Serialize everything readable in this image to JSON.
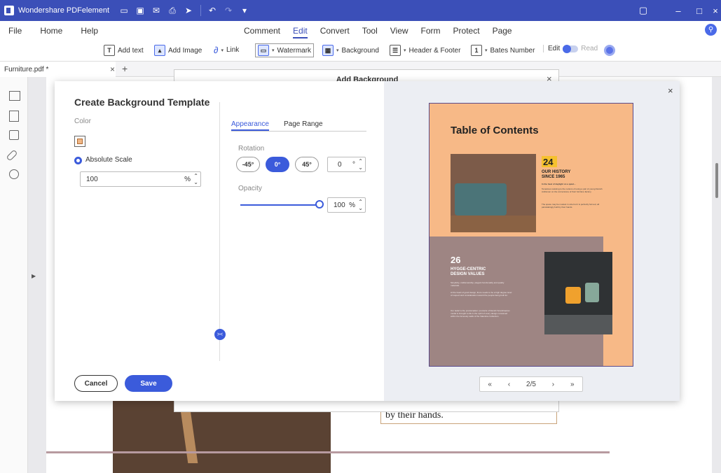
{
  "window": {
    "title": "Wondershare PDFelement",
    "controls": [
      "minimize",
      "maximize",
      "close"
    ]
  },
  "menubar": {
    "left": [
      "File",
      "Home",
      "Help"
    ],
    "center": [
      "Comment",
      "Edit",
      "Convert",
      "Tool",
      "View",
      "Form",
      "Protect",
      "Page"
    ],
    "active": "Edit"
  },
  "toolbar": {
    "add_text": "Add text",
    "add_image": "Add Image",
    "link": "Link",
    "watermark": "Watermark",
    "background": "Background",
    "header_footer": "Header & Footer",
    "bates_number": "Bates Number",
    "edit": "Edit",
    "read": "Read"
  },
  "tabs": {
    "document": "Furniture.pdf *",
    "new_tab_symbol": "+"
  },
  "document": {
    "visible_text": "by their hands."
  },
  "background_dialog": {
    "title": "Add Background",
    "close_symbol": "×"
  },
  "template_modal": {
    "title": "Create Background Template",
    "color_label": "Color",
    "color_value": "#f0b787",
    "scale_option": "Absolute Scale",
    "scale_value": "100",
    "scale_unit": "%",
    "tabs": {
      "appearance": "Appearance",
      "page_range": "Page Range",
      "active": "Appearance"
    },
    "rotation_label": "Rotation",
    "rotation_options": [
      "-45°",
      "0°",
      "45°"
    ],
    "rotation_selected": "0°",
    "rotation_custom_value": "0",
    "rotation_custom_unit": "°",
    "opacity_label": "Opacity",
    "opacity_value": "100",
    "opacity_unit": "%",
    "opacity_fraction": 1.0,
    "cancel_label": "Cancel",
    "save_label": "Save",
    "collapse_symbol": "><"
  },
  "preview": {
    "page_title": "Table of Contents",
    "section1_number": "24",
    "section1_heading": "OUR HISTORY\nSINCE 1965",
    "section1_text_a": "In the heat of daylight on a quiet...",
    "section1_text_b": "Tenacious resisting to the notions of using a pair of young Danish craftsmen on the cornerstone of their furniture factory.",
    "section1_text_c": "The space may be modest in size but it is perfectly formed, all painstakingly built by their hands.",
    "section2_number": "26",
    "section2_heading": "HYGGE-CENTRIC\nDESIGN VALUES",
    "section2_text_a": "Simplicity, craftsmanship, elegant functionality and quality materials.",
    "section2_text_b": "At the heart of good design, there needs to be a high degree level of respect and consideration toward the people being built for.",
    "section2_text_c": "Our belief is the proclamation: products of Danish Scandinavian model is brought to life in the spirit of every design conceived within the famously walls of the Valentine Collection.",
    "page_current": "2",
    "page_total": "5",
    "page_indicator": "2/5",
    "nav_first": "«",
    "nav_prev": "‹",
    "nav_next": "›",
    "nav_last": "»",
    "close_symbol": "×"
  },
  "colors": {
    "accent": "#3b5bdb",
    "titlebar": "#3b4fb8",
    "preview_peach": "#f7b987",
    "preview_mauve": "#9e8583"
  }
}
